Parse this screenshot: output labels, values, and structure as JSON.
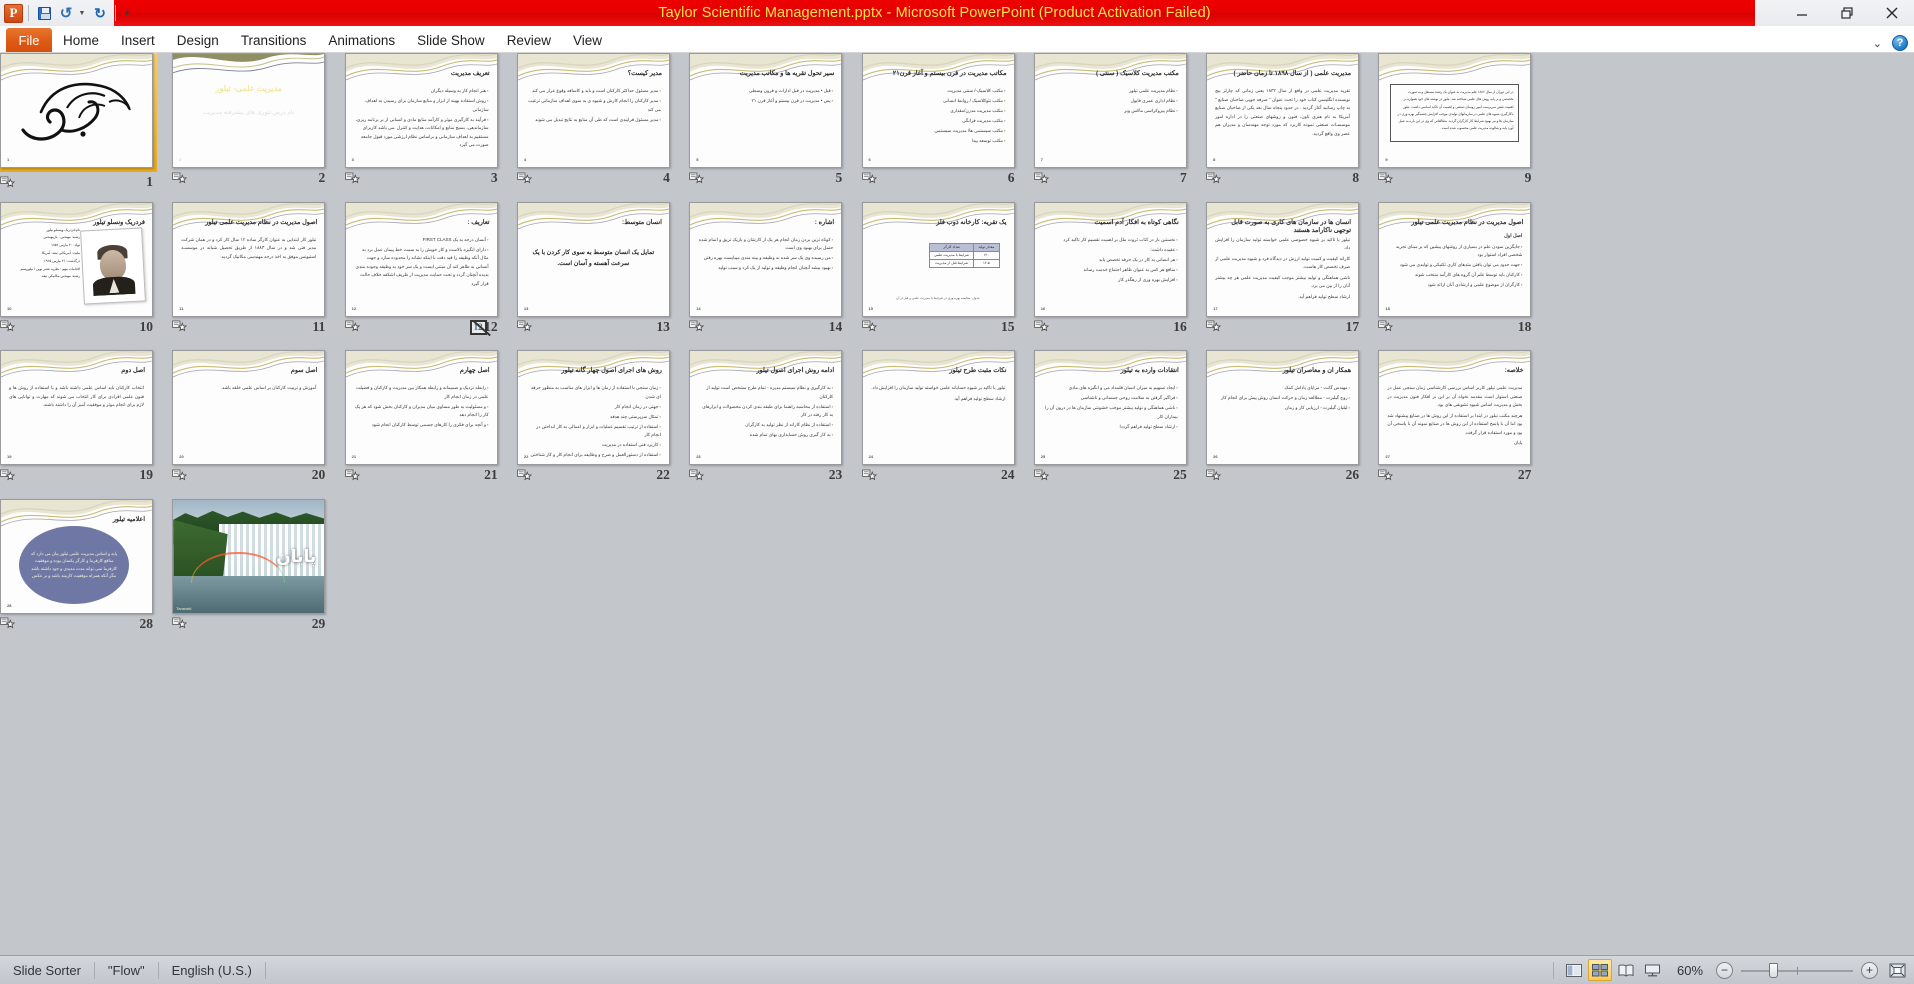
{
  "window": {
    "title": "Taylor Scientific Management.pptx  -  Microsoft PowerPoint (Product Activation Failed)",
    "minimize_label": "Minimize",
    "restore_label": "Restore Down",
    "close_label": "Close"
  },
  "quick_access": {
    "app_logo": "powerpoint-logo",
    "save": "Save",
    "undo": "Undo",
    "redo": "Repeat",
    "customize": "Customize Quick Access Toolbar"
  },
  "ribbon": {
    "file_tab": "File",
    "tabs": [
      "Home",
      "Insert",
      "Design",
      "Transitions",
      "Animations",
      "Slide Show",
      "Review",
      "View"
    ],
    "collapse": "Minimize the Ribbon",
    "help": "?"
  },
  "status": {
    "view_name": "Slide Sorter",
    "theme": "\"Flow\"",
    "language": "English (U.S.)",
    "zoom_percent": "60%",
    "zoom_out": "−",
    "zoom_in": "+",
    "views": [
      {
        "name": "normal-view-button",
        "label": "Normal",
        "active": false
      },
      {
        "name": "slide-sorter-view-button",
        "label": "Slide Sorter",
        "active": true
      },
      {
        "name": "reading-view-button",
        "label": "Reading View",
        "active": false
      },
      {
        "name": "slide-show-button",
        "label": "Slide Show",
        "active": false
      }
    ],
    "fit_to_window": "Fit slide to current window"
  },
  "hidden_slide_marker": "12",
  "slides": [
    {
      "n": "1",
      "kind": "calligraphy",
      "selected": true,
      "title": "بسم الله الرحمن الرحیم"
    },
    {
      "n": "2",
      "kind": "dark-title",
      "title": "مدیریت علمی-  تیلور",
      "subtitle": "نام درس:تئوری های پیشرفته مدیریت"
    },
    {
      "n": "3",
      "kind": "bullets",
      "title": "تعریف مدیریت",
      "bullets": [
        "هنر انجام کار به وسیله دیگران",
        "روش استفاده بهینه از ابزار و منابع سازمان برای رسیدن به اهداف سازمانی",
        "فرآیند به کارگیری موثر و کارآمد منابع مادی و انسانی از بر برنامه ریزی، سازماندهی، بسیج منابع و امکانات، هدایت و کنترل .می باشد کاربرای مستقیم به اهداف سازمانی و براساس نظام ارزشی مورد قبول جامعه صورت می گیرد"
      ]
    },
    {
      "n": "4",
      "kind": "bullets",
      "title": "مدیر کیست؟",
      "bullets": [
        "مدیر مسئول حداکثر کارکنان است و باید و کاسافه وقوع عرار می کند",
        "مدیر کارکنان را انجام کارش و شیوه ی به سوی اهداف سازمانی ترغیب می کند",
        "مدیر مسئول فرایندی است که طی آن منابع به نتایج تبدیل می شوند"
      ]
    },
    {
      "n": "5",
      "kind": "bullets",
      "title": "سیر تحول تقریه ها و مکاتب مدیریت",
      "bullets": [
        "قبل  •  مدیریت در قبل ادارات و قرون وسطی",
        "پس  •  مدیریت در قرن بیستم و آغاز قرن ۲۱"
      ]
    },
    {
      "n": "6",
      "kind": "bullets",
      "title": "مکاتب مدیریت در قرن بیستم  و آغاز قرن۲۱",
      "bullets": [
        "مکتب کلاسیک-/ سنتی مدیریت",
        "مکتب نئوکلاسیک / روابط انسانی",
        "مکتب مدیریت مدرن/مقداری",
        "مکتب مدیریت فرانگی",
        "مکتب سیستمی ها/ مدیریت سیستمی",
        "مکتب توسعه پیدا"
      ]
    },
    {
      "n": "7",
      "kind": "bullets",
      "title": "مکتب مدیریت  کلاسیک ( سنتی )",
      "bullets": [
        "نظام مدیریت علمی  تیلور",
        "نظام اداری عمری فایول",
        "نظام بیروکراسی ماکس وبر"
      ]
    },
    {
      "n": "8",
      "kind": "paras",
      "title": "مدیریت علمی ( از سال ۱۸۹۸ تا زمان حاضر )",
      "paras": [
        "تقریه مدیریت علمی در واقع از سال ۱۸۳۲ یعنی زمانی که چارلز بیج نویسنده انگلیسی کتاب خود را تحت عنوان \" صرفه جویی صاحبان صنایع \" به چاپ رسانید آغاز گردید . در حدود پنجاه سال بعد یکی از صاحبان صنایع آمریکا به نام هنری تاون، فنون و روشهای صنعتی را در اداره امور موسسـات صنعتی نموده کاربرد که مورد توجه مهندسان و مدیران هم عصر وی واقع گردید."
      ]
    },
    {
      "n": "9",
      "kind": "boxed",
      "box": "در این دوران از سال ۱۸۸۶ علم مدیریت به عنوان یک رشته مستقل و به صورت تخصصی و بر پایه روش های علمی شناخته شد. تیلور در نوشته های خود همواره بر اهمیت نقش سرپرست امور روسای صنعتی و اهمیت آن تاکید اساسی داشت. تیلور باکارگیری شیوه های علمی در سازمانهای تولیدی موجب افزایش چشمگیر بهره وری در سازمان ها و نیز بهبود شرایط کار کارگران گردید. مطالعاتی که وی در این باره به عمل آورد پایه و شالوده مدیریت علمی محسوب شده است ."
    },
    {
      "n": "10",
      "kind": "portrait",
      "title": "فردریک ونسلو تیلور",
      "details": [
        "نام:فردریک وینسلو تیلور",
        "رشته: مهندس - بازمهندس",
        "تولد: ۲۰ مارس ۱۸۵۶",
        "ملیت: آمریکایی  تبعه: آمریکا",
        "درگذشت: ۲۱ مارس ۱۹۱۵",
        "اقدامات مهم : نظریه عصر نوین / تیلوریسم",
        "رشته: مهندس مکانیکی   تبعه"
      ]
    },
    {
      "n": "11",
      "kind": "paras",
      "title": "اصول مدیریت در نظام مدیریت علمی تیلور",
      "paras": [
        "تیلور کار ابتدایی به عنوان کارگر ساده ۱۲ سال کار کرد و در  همان شرکت مدیر فنی شد و در سال ۱۸۸۳ از طریق تحصیل شبانه در موسسـه استیونس موفق به اخذ درجه مهندسی مکانیک گردید."
      ]
    },
    {
      "n": "12",
      "kind": "bullets",
      "title": "تعاریف :",
      "hidden": true,
      "bullets": [
        "آنسان درجه به یک FIRST CLASS",
        "دارای انگیزه بالاست و کار خویش را به سمت خط پیمان عمل برد به مثال آنکه وظیفه را قید دقت با اینکه نشانه را محدوده سازد و جهت آنسانی به ظاهر کند آن مبتنی ایست و یک سر خود به وظیفه وجوده مندی بدیده آنچنان گردد و تحت حمایت مدیریت از ظریف اشکفه خلاف حالت قرار گیرد"
      ]
    },
    {
      "n": "13",
      "kind": "center-title",
      "title": "انسان متوسط:",
      "big": "تمایل یک انسان متوسط به سوی کار کردن با یک سرعت آهسته و آسان است."
    },
    {
      "n": "14",
      "kind": "bullets",
      "title": "اشاره :",
      "bullets": [
        "کوتاه ترین بردن زمان انجام هر یک از کارشان و بازیک تریق و اتمام شده حتمل برای بهبود وی است",
        "من رسیده وی یک سر شده به وظیفه و بینه مندی میبایست بهره رفتن",
        "بهبود بیشه آنچنان انجام وظیفه و تولید از یک کرد و سبب تولید"
      ]
    },
    {
      "n": "15",
      "kind": "table",
      "title": "یک تقریه: کارخانه ذوب فلز",
      "table": {
        "head": [
          "مقدار تولید",
          "تعداد کارگر"
        ],
        "rows": [
          [
            "۱۲۰",
            "شرایط با مدیریت علمی"
          ],
          [
            "۱۲.۵",
            "شرایط قبل از مدیریت"
          ]
        ]
      },
      "note": "جدول:  مقایسه بهره وری در شرایط با مدیریت علمی و قبل از آن"
    },
    {
      "n": "16",
      "kind": "bullets",
      "title": "نگاهی کوتاه به افکار آدم اسمیت",
      "bullets": [
        "نخستین بار در کتاب ثروت ملل بر اهمیت تقسیم کار تاکید کرد",
        "عقیده داشت:",
        "هر انسانی به کار در یک حرفه تخصص یابد",
        "منافع هر کس به عنوان ظاهر اجتماع خدمت رساند",
        "افزایش بهره وری از رهگذر کار"
      ]
    },
    {
      "n": "17",
      "kind": "paras",
      "title": "انسان ها در سازمان های کاری به صورت قابل توجهی ناکارامد هستند",
      "paras": [
        "تیلور با تاکید بر شیوه خصوصی علمی خواسته تولید سازمان را افزایش داد.",
        "کارانه کیفیت و کمیت تولید ارزش در دیدگاه فرد و شیوه مدیریت علمی از صرف تخصص کار هاست.",
        "ناشی هماهنگی و تولید بیشتر موجب کیفیت مدیریت علمی هر چه بیشتر آنان را از بین می برد.",
        "ارشاد سطح تولید فراهم آید."
      ]
    },
    {
      "n": "18",
      "kind": "boxed-title",
      "title": "اصول مدیریت در نظام مدیریت علمی تیلور",
      "subtitle": "اصل اول",
      "bullets": [
        "جایگزین نمودن علم در بسیاری از روشهای پیشین که بر مبنای تجربه شخصی افراد استوار بود",
        "جهت حدود می توان یافتن متدهای کاری تکنیکی و تولیدی می شود",
        "کارکنان باید توسط علم آن گروه های کارآمد منتخب شوند",
        "کارگران از موضوع علمی و ارشادی آنان ارائه شود"
      ]
    },
    {
      "n": "19",
      "kind": "paras",
      "title": "اصل دوم",
      "paras": [
        "انتخاب کارکنان باید اساس علمی داشته باشد و با استفاده از روش ها و فنون علمی افرادی برای کار انتخاب می شوند که مهارت و توانایی های لازم برای انجام موثر و موفقیت آمیز آن را داشته باشند."
      ]
    },
    {
      "n": "20",
      "kind": "paras",
      "title": "اصل سوم",
      "paras": [
        "آموزش و تربیت کارکنان بر اساس علمی خلقه باشد."
      ]
    },
    {
      "n": "21",
      "kind": "bullets",
      "title": "اصل چهارم",
      "bullets": [
        "رابطه نزدیک و صمیمانه و رابطه همکار بین مدیریت و کارکنان و فضیلت علمی در زمان انجام کار",
        "و مسئولیت به طور مساوی میان مدیران و کارکنان بخش شود که هر یک کار را انجام دهد",
        "و آنچه برای فکری را کارهای جسمی توسط کارکنان انجام شود"
      ]
    },
    {
      "n": "22",
      "kind": "bullets",
      "title": "روش های اجرای اصول چهار گانه تیلور",
      "bullets": [
        "زمان سنجی با استفاده از زمان ها و ابزار های مناسب به منظور حرفه ای شدن",
        "جهتی در زمان انجام کار",
        "تمثال سرپرستی چند هدفه",
        "استفاده از ترتیب تقسیم عملیات و ابزار و اعمالی به کار انداختن در انجام کار",
        "کاربرد فنی استفاده در مدیریت",
        "استفاده از دستورالعمل و صرح و وظایفه برای انجام کار و کار شناختی"
      ]
    },
    {
      "n": "23",
      "kind": "bullets",
      "title": "ادامه روش اجرای اصول تیلور",
      "bullets": [
        "به کارگیری و نظام سیستم مدیره - تمام طرح مشخص است تولید از کارکنان",
        "استفاده از محاسبه راهنما برای طبقه بندی کردن محصولات و ابزارهای به کار رفته در کار",
        "استفاده از نظام کارانه از نظر تولید به کارگران",
        "به کار گیری روش حسابداری بهای تمام شده"
      ]
    },
    {
      "n": "24",
      "kind": "paras",
      "title": "نکات مثبت طرح تیلور",
      "paras": [
        "تیلور با تاکید بر شیوه حسابانه علمی خواسته تولید سازمان را افزایش داد.",
        "ارشاد سطح تولید فراهم آید."
      ]
    },
    {
      "n": "25",
      "kind": "bullets",
      "title": "انتقادات وارده به تیلور",
      "bullets": [
        "ایجاد تسهیم به میزان انسان قلمداد می و انگیزه های مادی",
        "فراگیر گرفتن به سلامت روحی جسمانی و ناشناسی",
        "ناشی هماهنگی و تولید بیشتر موجب خشونتی سازمان ها در درون آن را بیماران کار",
        "ارشاد سطح تولید فراهم گرددا"
      ]
    },
    {
      "n": "26",
      "kind": "bullets",
      "title": "همکار ان و معاصران تیلور",
      "bullets": [
        "مهندس گانت - مزایای پاداش کمک",
        "زوج گیلبرت - مطالعه زمان و حرکت انسان روش پیش برای انجام کار",
        "لیلیان گیلبرت - ارزیابی کار و زمان"
      ]
    },
    {
      "n": "27",
      "kind": "paras",
      "title": "خلاصه:",
      "paras": [
        "مدیریت علمی تیلور کاربر اساس بررسی کارشناسی زمان سنجی عمل در صنعتی استوار است مقدمه نخواه آن بر این بر افکار فنون مدیریت در بخش و مدیریت اساس شیوه تشویقی های بود.",
        "هرچند مکتب تیلور در ابتدا بر استفاده از این روش ها در صنایع پیشنهاد شد بود اما آن با پاسخ استفاده از این روش ها در صنایع نمونه آن با پاسخی آن بود و مورد استفاده قرار گرفت.",
        "پایان"
      ]
    },
    {
      "n": "28",
      "kind": "ellipse",
      "title": "اعلامیه تیلور",
      "ellipse_text": "پایه  و اساس مدیریت علمی تیلور بیان می دارد که منافع کارفرما و کارگر یکسان  بوده و موفقیت کارفرما نمی تواند مدت مدیدی و جود داشته باشد مگر آنکه همراه موفقیت کارمند باشد  و بر عکس"
    },
    {
      "n": "29",
      "kind": "waterfall",
      "word": "پایان",
      "tag": "Taranaki"
    }
  ]
}
